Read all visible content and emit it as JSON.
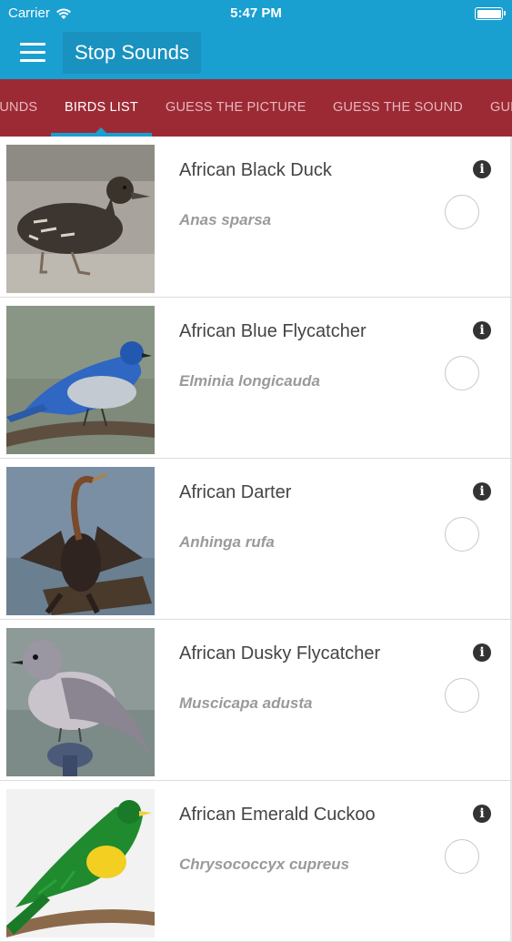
{
  "status_bar": {
    "carrier": "Carrier",
    "time": "5:47 PM"
  },
  "app_bar": {
    "stop_label": "Stop Sounds"
  },
  "tabs": [
    {
      "label": "SOUNDS"
    },
    {
      "label": "BIRDS LIST"
    },
    {
      "label": "GUESS THE PICTURE"
    },
    {
      "label": "GUESS THE SOUND"
    },
    {
      "label": "GUESS"
    }
  ],
  "birds": [
    {
      "name": "African Black Duck",
      "latin": "Anas sparsa",
      "info": "i"
    },
    {
      "name": "African Blue Flycatcher",
      "latin": "Elminia longicauda",
      "info": "i"
    },
    {
      "name": "African Darter",
      "latin": "Anhinga rufa",
      "info": "i"
    },
    {
      "name": "African Dusky Flycatcher",
      "latin": "Muscicapa adusta",
      "info": "i"
    },
    {
      "name": "African Emerald Cuckoo",
      "latin": "Chrysococcyx cupreus",
      "info": "i"
    }
  ],
  "colors": {
    "primary": "#1a9fd1",
    "tab_bar": "#9c2a35",
    "tab_active": "#ffffff",
    "tab_inactive": "#e8b7bc"
  }
}
